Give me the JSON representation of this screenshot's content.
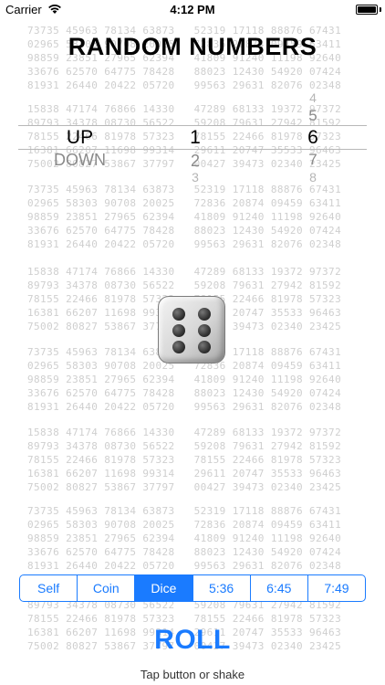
{
  "status_bar": {
    "carrier": "Carrier",
    "time": "4:12 PM"
  },
  "title": "RANDOM NUMBERS",
  "picker": {
    "direction": {
      "above": "",
      "selected": "UP",
      "below": [
        "DOWN"
      ]
    },
    "first": {
      "selected": "1",
      "below": [
        "2",
        "3"
      ]
    },
    "second": {
      "above": [
        "4",
        "5"
      ],
      "selected": "6",
      "below": [
        "7",
        "8"
      ]
    }
  },
  "die": {
    "face_value": 6,
    "icon": "die-six-icon"
  },
  "segmented": {
    "items": [
      "Self",
      "Coin",
      "Dice",
      "5:36",
      "6:45",
      "7:49"
    ],
    "selected_index": 2
  },
  "roll_button": "ROLL",
  "hint": "Tap button or shake",
  "colors": {
    "accent": "#1a7bff",
    "background_digits": "#cfcfcf"
  },
  "background_numbers": [
    [
      "73735 45963 78134 63873",
      "52319 17118 88876 67431"
    ],
    [
      "02965 58303 90708 20025",
      "72836 20874 09459 63411"
    ],
    [
      "98859 23851 27965 62394",
      "41809 91240 11198 92640"
    ],
    [
      "33676 62570 64775 78428",
      "88023 12430 54920 07424"
    ],
    [
      "81931 26440 20422 05720",
      "99563 29631 82076 02348"
    ],
    [
      "15838 47174 76866 14330",
      "47289 68133 19372 97372"
    ],
    [
      "89793 34378 08730 56522",
      "59208 79631 27942 81592"
    ],
    [
      "78155 22466 81978 57323",
      "78155 22466 81978 57323"
    ],
    [
      "16381 66207 11698 99314",
      "29611 20747 35533 96463"
    ],
    [
      "75002 80827 53867 37797",
      "00427 39473 02340 23425"
    ]
  ]
}
